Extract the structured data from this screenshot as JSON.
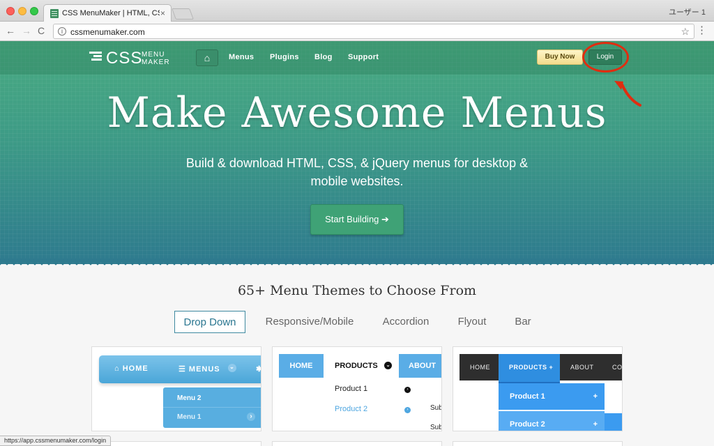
{
  "browser": {
    "tab_title": "CSS MenuMaker | HTML, CSS,",
    "tab_close": "×",
    "user_label": "ユーザー 1",
    "nav_back": "←",
    "nav_forward": "→",
    "nav_reload": "C",
    "url": "cssmenumaker.com",
    "info_icon": "i",
    "bookmark_icon": "☆",
    "menu_icon": "⋮",
    "status_url": "https://app.cssmenumaker.com/login"
  },
  "site": {
    "logo_main": "CSS",
    "logo_line1": "MENU",
    "logo_line2": "MAKER",
    "home_icon": "⌂",
    "nav": [
      "Menus",
      "Plugins",
      "Blog",
      "Support"
    ],
    "buy_now": "Buy Now",
    "login": "Login",
    "annotation_color": "#e02d10"
  },
  "hero": {
    "title": "Make Awesome Menus",
    "subtitle": "Build & download HTML, CSS, & jQuery menus for desktop & mobile websites.",
    "cta": "Start Building ➔"
  },
  "themes": {
    "heading": "65+ Menu Themes to Choose From",
    "tabs": [
      "Drop Down",
      "Responsive/Mobile",
      "Accordion",
      "Flyout",
      "Bar"
    ],
    "active_tab": "Drop Down"
  },
  "previews": {
    "card1": {
      "home": "⌂ HOME",
      "menus": "☰ MENUS",
      "menus_chevron": "⌄",
      "gear": "✱",
      "sub": [
        "Menu 2",
        "Menu 1"
      ],
      "sub_arrow": "›"
    },
    "card2": {
      "home": "HOME",
      "products": "PRODUCTS",
      "products_chevron": "⌄",
      "about": "ABOUT",
      "items": [
        "Product 1",
        "Product 2"
      ],
      "item_arrow": "›",
      "subs": [
        "Sub",
        "Sub"
      ]
    },
    "card3": {
      "nav": [
        "HOME",
        "PRODUCTS +",
        "ABOUT",
        "CON"
      ],
      "items": [
        "Product 1",
        "Product 2"
      ],
      "item_plus": "+"
    }
  }
}
